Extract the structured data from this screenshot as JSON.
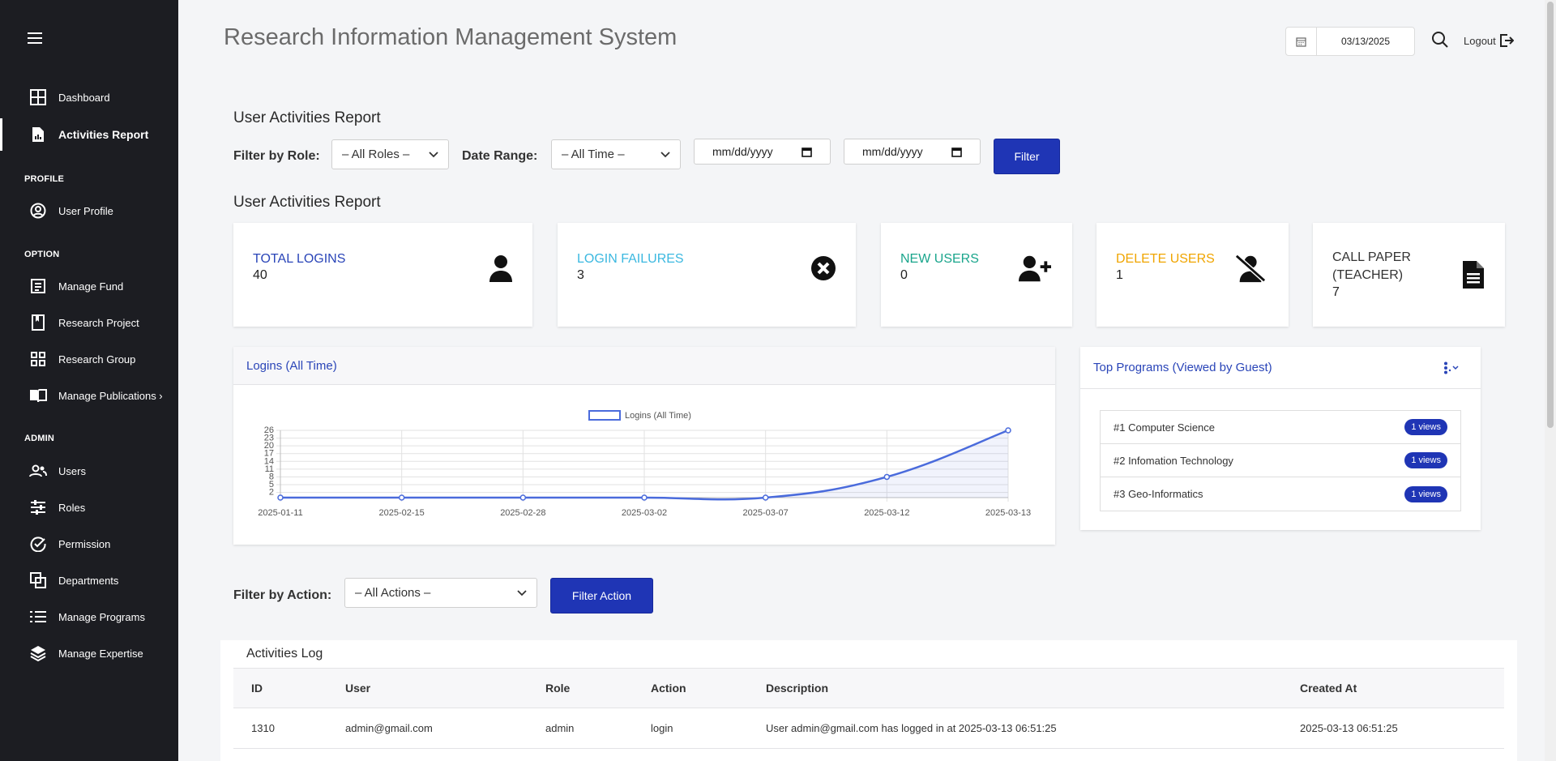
{
  "app": {
    "title": "Research Information Management System",
    "date": "03/13/2025",
    "logout_label": "Logout"
  },
  "sidebar": {
    "items": [
      {
        "label": "Dashboard",
        "icon": "dashboard-icon"
      },
      {
        "label": "Activities Report",
        "icon": "report-icon"
      }
    ],
    "profile_label": "PROFILE",
    "profile_items": [
      {
        "label": "User Profile",
        "icon": "user-circle-icon"
      }
    ],
    "option_label": "OPTION",
    "option_items": [
      {
        "label": "Manage Fund",
        "icon": "document-list-icon"
      },
      {
        "label": "Research Project",
        "icon": "book-icon"
      },
      {
        "label": "Research Group",
        "icon": "grid-icon"
      },
      {
        "label": "Manage Publications ›",
        "icon": "open-book-icon"
      }
    ],
    "admin_label": "ADMIN",
    "admin_items": [
      {
        "label": "Users",
        "icon": "users-icon"
      },
      {
        "label": "Roles",
        "icon": "roles-icon"
      },
      {
        "label": "Permission",
        "icon": "check-circle-icon"
      },
      {
        "label": "Departments",
        "icon": "copy-icon"
      },
      {
        "label": "Manage Programs",
        "icon": "list-icon"
      },
      {
        "label": "Manage Expertise",
        "icon": "layers-icon"
      }
    ]
  },
  "filters": {
    "section_title": "User Activities Report",
    "role_label": "Filter by Role:",
    "role_value": "– All Roles –",
    "range_label": "Date Range:",
    "range_value": "– All Time –",
    "start_date": "mm/dd/yyyy",
    "end_date": "mm/dd/yyyy",
    "filter_button": "Filter"
  },
  "report": {
    "title": "User Activities Report",
    "cards": [
      {
        "label": "TOTAL LOGINS",
        "value": "40",
        "color": "#2a45b8",
        "icon": "user-icon"
      },
      {
        "label": "LOGIN FAILURES",
        "value": "3",
        "color": "#3bb8e0",
        "icon": "x-circle-icon"
      },
      {
        "label": "NEW USERS",
        "value": "0",
        "color": "#1aa58c",
        "icon": "user-plus-icon"
      },
      {
        "label": "DELETE USERS",
        "value": "1",
        "color": "#f0a500",
        "icon": "user-slash-icon"
      },
      {
        "label": "CALL PAPER",
        "label2": "(TEACHER)",
        "value": "7",
        "color": "#333333",
        "icon": "file-icon"
      }
    ]
  },
  "chart_panel": {
    "title": "Logins (All Time)"
  },
  "chart_data": {
    "type": "line",
    "x": [
      "2025-01-11",
      "2025-02-15",
      "2025-02-28",
      "2025-03-02",
      "2025-03-07",
      "2025-03-12",
      "2025-03-13"
    ],
    "series": [
      {
        "name": "Logins (All Time)",
        "values": [
          0,
          0,
          0,
          0,
          0,
          8,
          26
        ]
      }
    ],
    "yticks": [
      "26",
      "23",
      "20",
      "17",
      "14",
      "11",
      "8",
      "5",
      "2"
    ],
    "ylim": [
      0,
      26
    ],
    "grid": true,
    "legend": "top"
  },
  "programs": {
    "title": "Top Programs (Viewed by Guest)",
    "items": [
      {
        "label": "#1 Computer Science",
        "badge": "1 views"
      },
      {
        "label": "#2 Infomation Technology",
        "badge": "1 views"
      },
      {
        "label": "#3 Geo-Informatics",
        "badge": "1 views"
      }
    ]
  },
  "action_filter": {
    "label": "Filter by Action:",
    "value": "– All Actions –",
    "button": "Filter Action"
  },
  "log": {
    "title": "Activities Log",
    "headers": [
      "ID",
      "User",
      "Role",
      "Action",
      "Description",
      "Created At"
    ],
    "rows": [
      {
        "id": "1310",
        "user": "admin@gmail.com",
        "role": "admin",
        "action": "login",
        "description": "User admin@gmail.com has logged in at 2025-03-13 06:51:25",
        "created_at": "2025-03-13 06:51:25"
      }
    ]
  }
}
